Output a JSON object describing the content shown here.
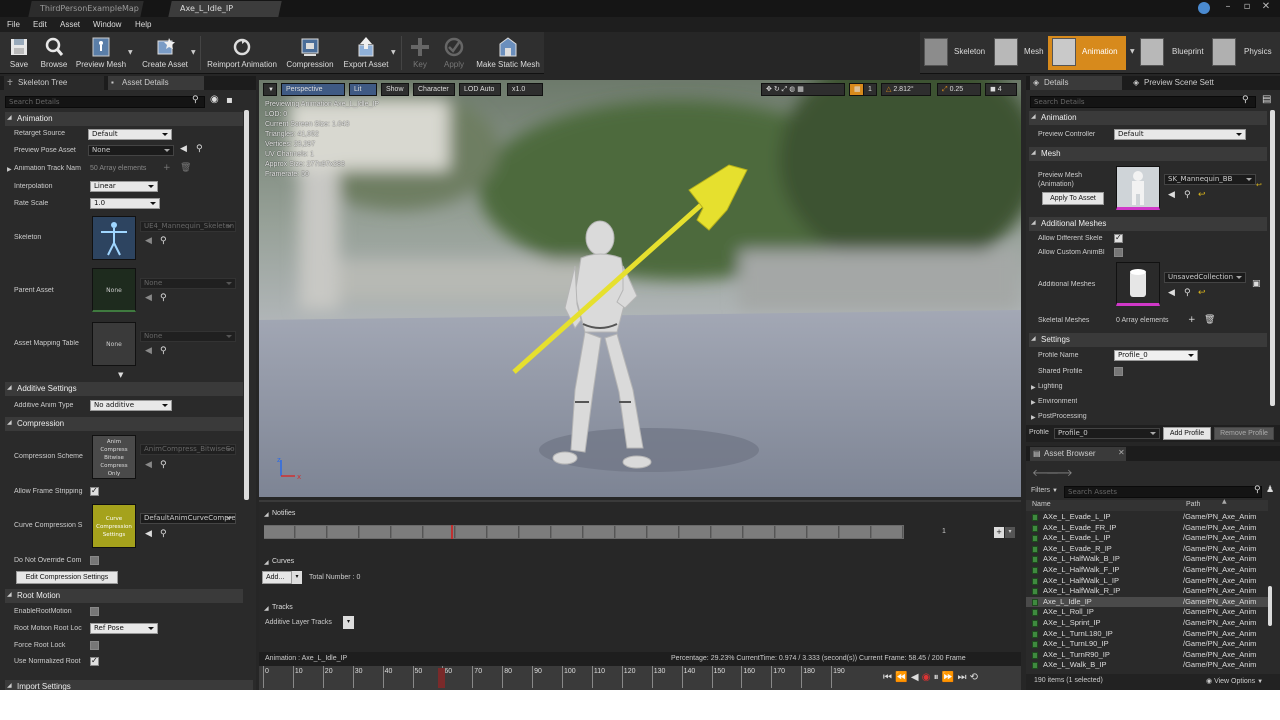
{
  "window": {
    "tabs": [
      "ThirdPersonExampleMap",
      "Axe_L_Idle_IP"
    ]
  },
  "menu": [
    "File",
    "Edit",
    "Asset",
    "Window",
    "Help"
  ],
  "toolbar": {
    "buttons": [
      {
        "label": "Save",
        "icon": "save-icon"
      },
      {
        "label": "Browse",
        "icon": "browse-icon"
      },
      {
        "label": "Preview Mesh",
        "icon": "preview-mesh-icon"
      },
      {
        "label": "Create Asset",
        "icon": "create-asset-icon"
      },
      {
        "label": "Reimport Animation",
        "icon": "reimport-icon"
      },
      {
        "label": "Compression",
        "icon": "compression-icon"
      },
      {
        "label": "Export Asset",
        "icon": "export-icon"
      },
      {
        "label": "Key",
        "icon": "key-plus-icon"
      },
      {
        "label": "Apply",
        "icon": "apply-icon"
      },
      {
        "label": "Make Static Mesh",
        "icon": "static-mesh-icon"
      }
    ],
    "modes": [
      "Skeleton",
      "Mesh",
      "Animation",
      "Blueprint",
      "Physics"
    ],
    "active_mode": "Animation"
  },
  "left_panel": {
    "tabs": [
      "Skeleton Tree",
      "Asset Details"
    ],
    "search_placeholder": "Search Details",
    "sections": {
      "animation": "Animation",
      "additive": "Additive Settings",
      "compression": "Compression",
      "root_motion": "Root Motion",
      "import": "Import Settings"
    },
    "retarget_source": {
      "label": "Retarget Source",
      "value": "Default"
    },
    "preview_pose": {
      "label": "Preview Pose Asset",
      "value": "None"
    },
    "anim_track_names": {
      "label": "Animation Track Nam",
      "value": "50 Array elements"
    },
    "interpolation": {
      "label": "Interpolation",
      "value": "Linear"
    },
    "rate_scale": {
      "label": "Rate Scale",
      "value": "1.0"
    },
    "skeleton": {
      "label": "Skeleton",
      "value": "UE4_Mannequin_Skeleton"
    },
    "parent_asset": {
      "label": "Parent Asset",
      "thumb": "None",
      "value": "None"
    },
    "asset_mapping": {
      "label": "Asset Mapping Table",
      "thumb": "None",
      "value": "None"
    },
    "additive_type": {
      "label": "Additive Anim Type",
      "value": "No additive"
    },
    "compression_scheme": {
      "label": "Compression Scheme",
      "thumb": "Anim Compress Bitwise Compress Only",
      "value": "AnimCompress_BitwiseCo"
    },
    "allow_frame_stripping": {
      "label": "Allow Frame Stripping"
    },
    "curve_compression": {
      "label": "Curve Compression S",
      "thumb": "Curve Compression Settings",
      "value": "DefaultAnimCurveCompre"
    },
    "do_not_override": {
      "label": "Do Not Override Com"
    },
    "edit_compression_btn": "Edit Compression Settings",
    "enable_root_motion": {
      "label": "EnableRootMotion"
    },
    "root_motion_lock": {
      "label": "Root Motion Root Loc",
      "value": "Ref Pose"
    },
    "force_root_lock": {
      "label": "Force Root Lock"
    },
    "use_normalized_root": {
      "label": "Use Normalized Root"
    }
  },
  "viewport": {
    "chips": [
      "Perspective",
      "Lit",
      "Show",
      "Character",
      "LOD Auto",
      "x1.0"
    ],
    "right_values": [
      "1",
      "2.812°",
      "0.25",
      "4"
    ],
    "stats": [
      "Previewing Animation Axe_L_Idle_IP",
      "LOD: 0",
      "Current Screen Size: 1.043",
      "Triangles: 41,052",
      "Vertices: 23,297",
      "UV Channels: 1",
      "Approx Size: 277x97x283",
      "Framerate: 50"
    ]
  },
  "timeline": {
    "notifies": "Notifies",
    "notify_track_count": "1",
    "curves": "Curves",
    "add_label": "Add...",
    "total_number": "Total Number : 0",
    "tracks": "Tracks",
    "additive_layer": "Additive Layer Tracks",
    "animation_name": "Animation : Axe_L_Idle_IP",
    "status": "Percentage:  29.23% CurrentTime:  0.974 / 3.333 (second(s)) Current Frame:  58.45 / 200 Frame",
    "ticks": [
      "0",
      "10",
      "20",
      "30",
      "40",
      "50",
      "60",
      "70",
      "80",
      "90",
      "100",
      "110",
      "120",
      "130",
      "140",
      "150",
      "160",
      "170",
      "180",
      "190"
    ],
    "playhead_frame": 58.45,
    "total_frames": 200
  },
  "details_panel": {
    "tabs": [
      "Details",
      "Preview Scene Sett"
    ],
    "search_placeholder": "Search Details",
    "sections": {
      "animation": "Animation",
      "mesh": "Mesh",
      "additional": "Additional Meshes",
      "settings": "Settings"
    },
    "preview_controller": {
      "label": "Preview Controller",
      "value": "Default"
    },
    "preview_mesh": {
      "label": "Preview Mesh (Animation)",
      "value": "SK_Mannequin_BB",
      "button": "Apply To Asset"
    },
    "allow_diff_skel": "Allow Different Skele",
    "allow_custom_anim": "Allow Custom AnimBl",
    "additional_meshes": {
      "label": "Additional Meshes",
      "value": "UnsavedCollection"
    },
    "skeletal_meshes": {
      "label": "Skeletal Meshes",
      "value": "0 Array elements"
    },
    "profile_name": {
      "label": "Profile Name",
      "value": "Profile_0"
    },
    "shared_profile": "Shared Profile",
    "subsections": [
      "Lighting",
      "Environment",
      "PostProcessing"
    ],
    "profile_bar": {
      "label": "Profile",
      "value": "Profile_0",
      "add": "Add Profile",
      "remove": "Remove Profile"
    }
  },
  "asset_browser": {
    "tab": "Asset Browser",
    "filters": "Filters",
    "search_placeholder": "Search Assets",
    "col_name": "Name",
    "col_path": "Path",
    "rows": [
      {
        "name": "AXe_L_Evade_L_IP",
        "path": "/Game/PN_Axe_Anim"
      },
      {
        "name": "AXe_L_Evade_FR_IP",
        "path": "/Game/PN_Axe_Anim"
      },
      {
        "name": "AXe_L_Evade_L_IP",
        "path": "/Game/PN_Axe_Anim"
      },
      {
        "name": "AXe_L_Evade_R_IP",
        "path": "/Game/PN_Axe_Anim"
      },
      {
        "name": "AXe_L_HalfWalk_B_IP",
        "path": "/Game/PN_Axe_Anim"
      },
      {
        "name": "AXe_L_HalfWalk_F_IP",
        "path": "/Game/PN_Axe_Anim"
      },
      {
        "name": "AXe_L_HalfWalk_L_IP",
        "path": "/Game/PN_Axe_Anim"
      },
      {
        "name": "AXe_L_HalfWalk_R_IP",
        "path": "/Game/PN_Axe_Anim"
      },
      {
        "name": "Axe_L_Idle_IP",
        "path": "/Game/PN_Axe_Anim"
      },
      {
        "name": "AXe_L_Roll_IP",
        "path": "/Game/PN_Axe_Anim"
      },
      {
        "name": "AXe_L_Sprint_IP",
        "path": "/Game/PN_Axe_Anim"
      },
      {
        "name": "AXe_L_TurnL180_IP",
        "path": "/Game/PN_Axe_Anim"
      },
      {
        "name": "AXe_L_TurnL90_IP",
        "path": "/Game/PN_Axe_Anim"
      },
      {
        "name": "AXe_L_TurnR90_IP",
        "path": "/Game/PN_Axe_Anim"
      },
      {
        "name": "AXe_L_Walk_B_IP",
        "path": "/Game/PN_Axe_Anim"
      }
    ],
    "selected_index": 8,
    "status": "190 items (1 selected)",
    "view_options": "View Options"
  }
}
